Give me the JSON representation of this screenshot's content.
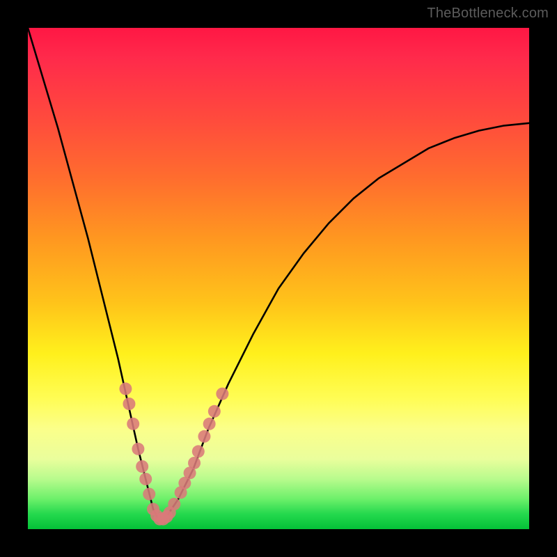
{
  "watermark": "TheBottleneck.com",
  "chart_data": {
    "type": "line",
    "title": "",
    "xlabel": "",
    "ylabel": "",
    "xlim": [
      0,
      100
    ],
    "ylim": [
      0,
      100
    ],
    "grid": false,
    "legend": false,
    "series": [
      {
        "name": "curve",
        "x": [
          0,
          3,
          6,
          9,
          12,
          15,
          18,
          20,
          22,
          24,
          25,
          26,
          27,
          28,
          30,
          33,
          36,
          40,
          45,
          50,
          55,
          60,
          65,
          70,
          75,
          80,
          85,
          90,
          95,
          100
        ],
        "y": [
          100,
          90,
          80,
          69,
          58,
          46,
          34,
          25,
          16,
          8,
          4,
          2,
          2,
          3,
          6,
          12,
          20,
          29,
          39,
          48,
          55,
          61,
          66,
          70,
          73,
          76,
          78,
          79.5,
          80.5,
          81
        ]
      }
    ],
    "markers": [
      {
        "name": "dots",
        "points": [
          {
            "x": 19.5,
            "y": 28
          },
          {
            "x": 20.2,
            "y": 25
          },
          {
            "x": 21.0,
            "y": 21
          },
          {
            "x": 22.0,
            "y": 16
          },
          {
            "x": 22.8,
            "y": 12.5
          },
          {
            "x": 23.5,
            "y": 10
          },
          {
            "x": 24.2,
            "y": 7
          },
          {
            "x": 25.0,
            "y": 4
          },
          {
            "x": 25.7,
            "y": 2.7
          },
          {
            "x": 26.3,
            "y": 2.0
          },
          {
            "x": 27.0,
            "y": 2.0
          },
          {
            "x": 27.7,
            "y": 2.5
          },
          {
            "x": 28.3,
            "y": 3.3
          },
          {
            "x": 29.2,
            "y": 5.0
          },
          {
            "x": 30.5,
            "y": 7.3
          },
          {
            "x": 31.3,
            "y": 9.2
          },
          {
            "x": 32.3,
            "y": 11.2
          },
          {
            "x": 33.2,
            "y": 13.2
          },
          {
            "x": 34.0,
            "y": 15.5
          },
          {
            "x": 35.2,
            "y": 18.5
          },
          {
            "x": 36.2,
            "y": 21.0
          },
          {
            "x": 37.2,
            "y": 23.5
          },
          {
            "x": 38.8,
            "y": 27.0
          }
        ]
      }
    ],
    "notes": "Values estimated from pixel positions; y is percent of plot height from bottom, x is percent of plot width from left."
  }
}
